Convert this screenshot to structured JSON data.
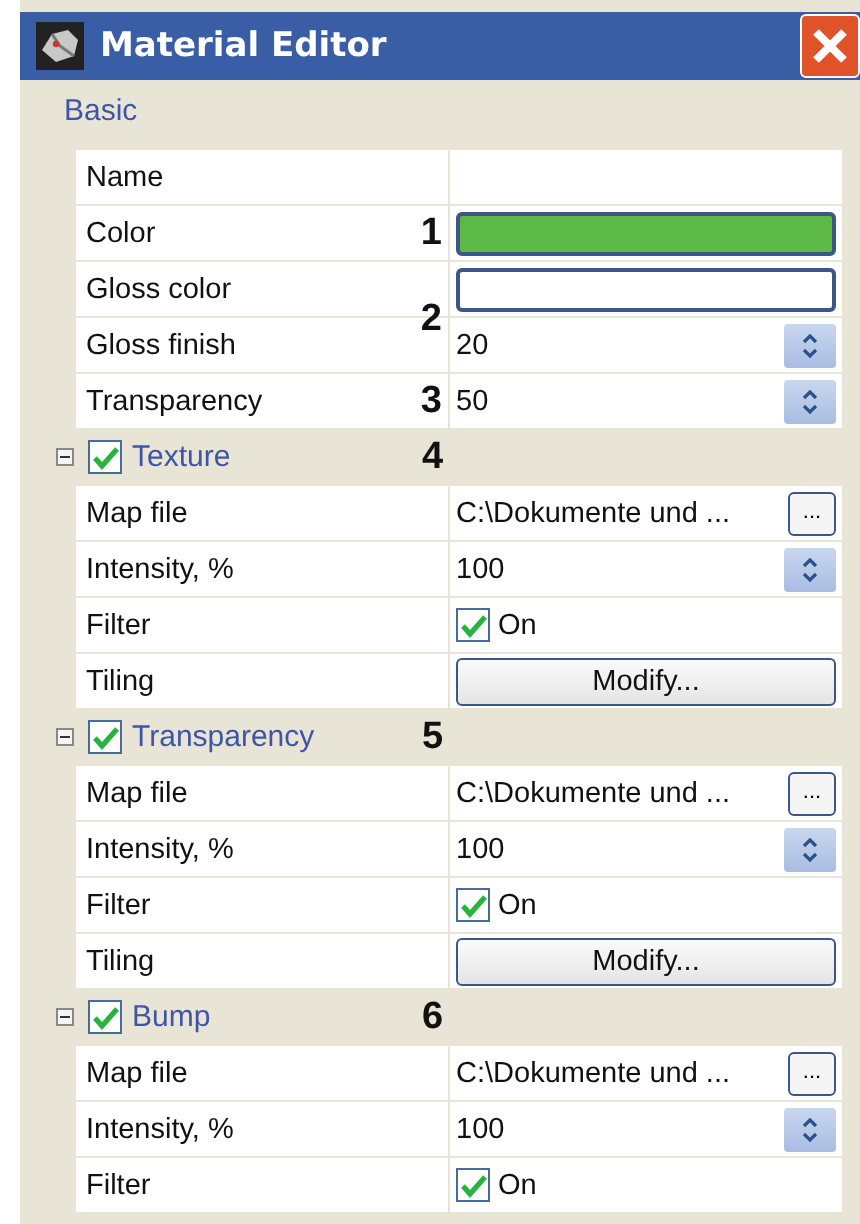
{
  "window": {
    "title": "Material Editor"
  },
  "basic": {
    "title": "Basic",
    "rows": [
      {
        "label": "Name",
        "kind": "text"
      },
      {
        "label": "Color",
        "kind": "color",
        "color": "#5cb946",
        "callout": "1"
      },
      {
        "label": "Gloss color",
        "kind": "color",
        "color": "#ffffff"
      },
      {
        "label": "Gloss finish",
        "kind": "spin",
        "value": "20",
        "callout": "2"
      },
      {
        "label": "Transparency",
        "kind": "spin",
        "value": "50",
        "callout": "3"
      }
    ]
  },
  "groups": [
    {
      "title": "Texture",
      "expanded": true,
      "checked": true,
      "callout": "4",
      "rows": [
        {
          "label": "Map file",
          "kind": "file",
          "value": "C:\\Dokumente und ...",
          "button": "..."
        },
        {
          "label": "Intensity, %",
          "kind": "spin",
          "value": "100"
        },
        {
          "label": "Filter",
          "kind": "check",
          "checked": true,
          "value": "On"
        },
        {
          "label": "Tiling",
          "kind": "button",
          "value": "Modify..."
        }
      ]
    },
    {
      "title": "Transparency",
      "expanded": true,
      "checked": true,
      "callout": "5",
      "rows": [
        {
          "label": "Map file",
          "kind": "file",
          "value": "C:\\Dokumente und ...",
          "button": "..."
        },
        {
          "label": "Intensity, %",
          "kind": "spin",
          "value": "100"
        },
        {
          "label": "Filter",
          "kind": "check",
          "checked": true,
          "value": "On"
        },
        {
          "label": "Tiling",
          "kind": "button",
          "value": "Modify..."
        }
      ]
    },
    {
      "title": "Bump",
      "expanded": true,
      "checked": true,
      "callout": "6",
      "rows": [
        {
          "label": "Map file",
          "kind": "file",
          "value": "C:\\Dokumente und ...",
          "button": "..."
        },
        {
          "label": "Intensity, %",
          "kind": "spin",
          "value": "100"
        },
        {
          "label": "Filter",
          "kind": "check",
          "checked": true,
          "value": "On"
        }
      ]
    }
  ]
}
